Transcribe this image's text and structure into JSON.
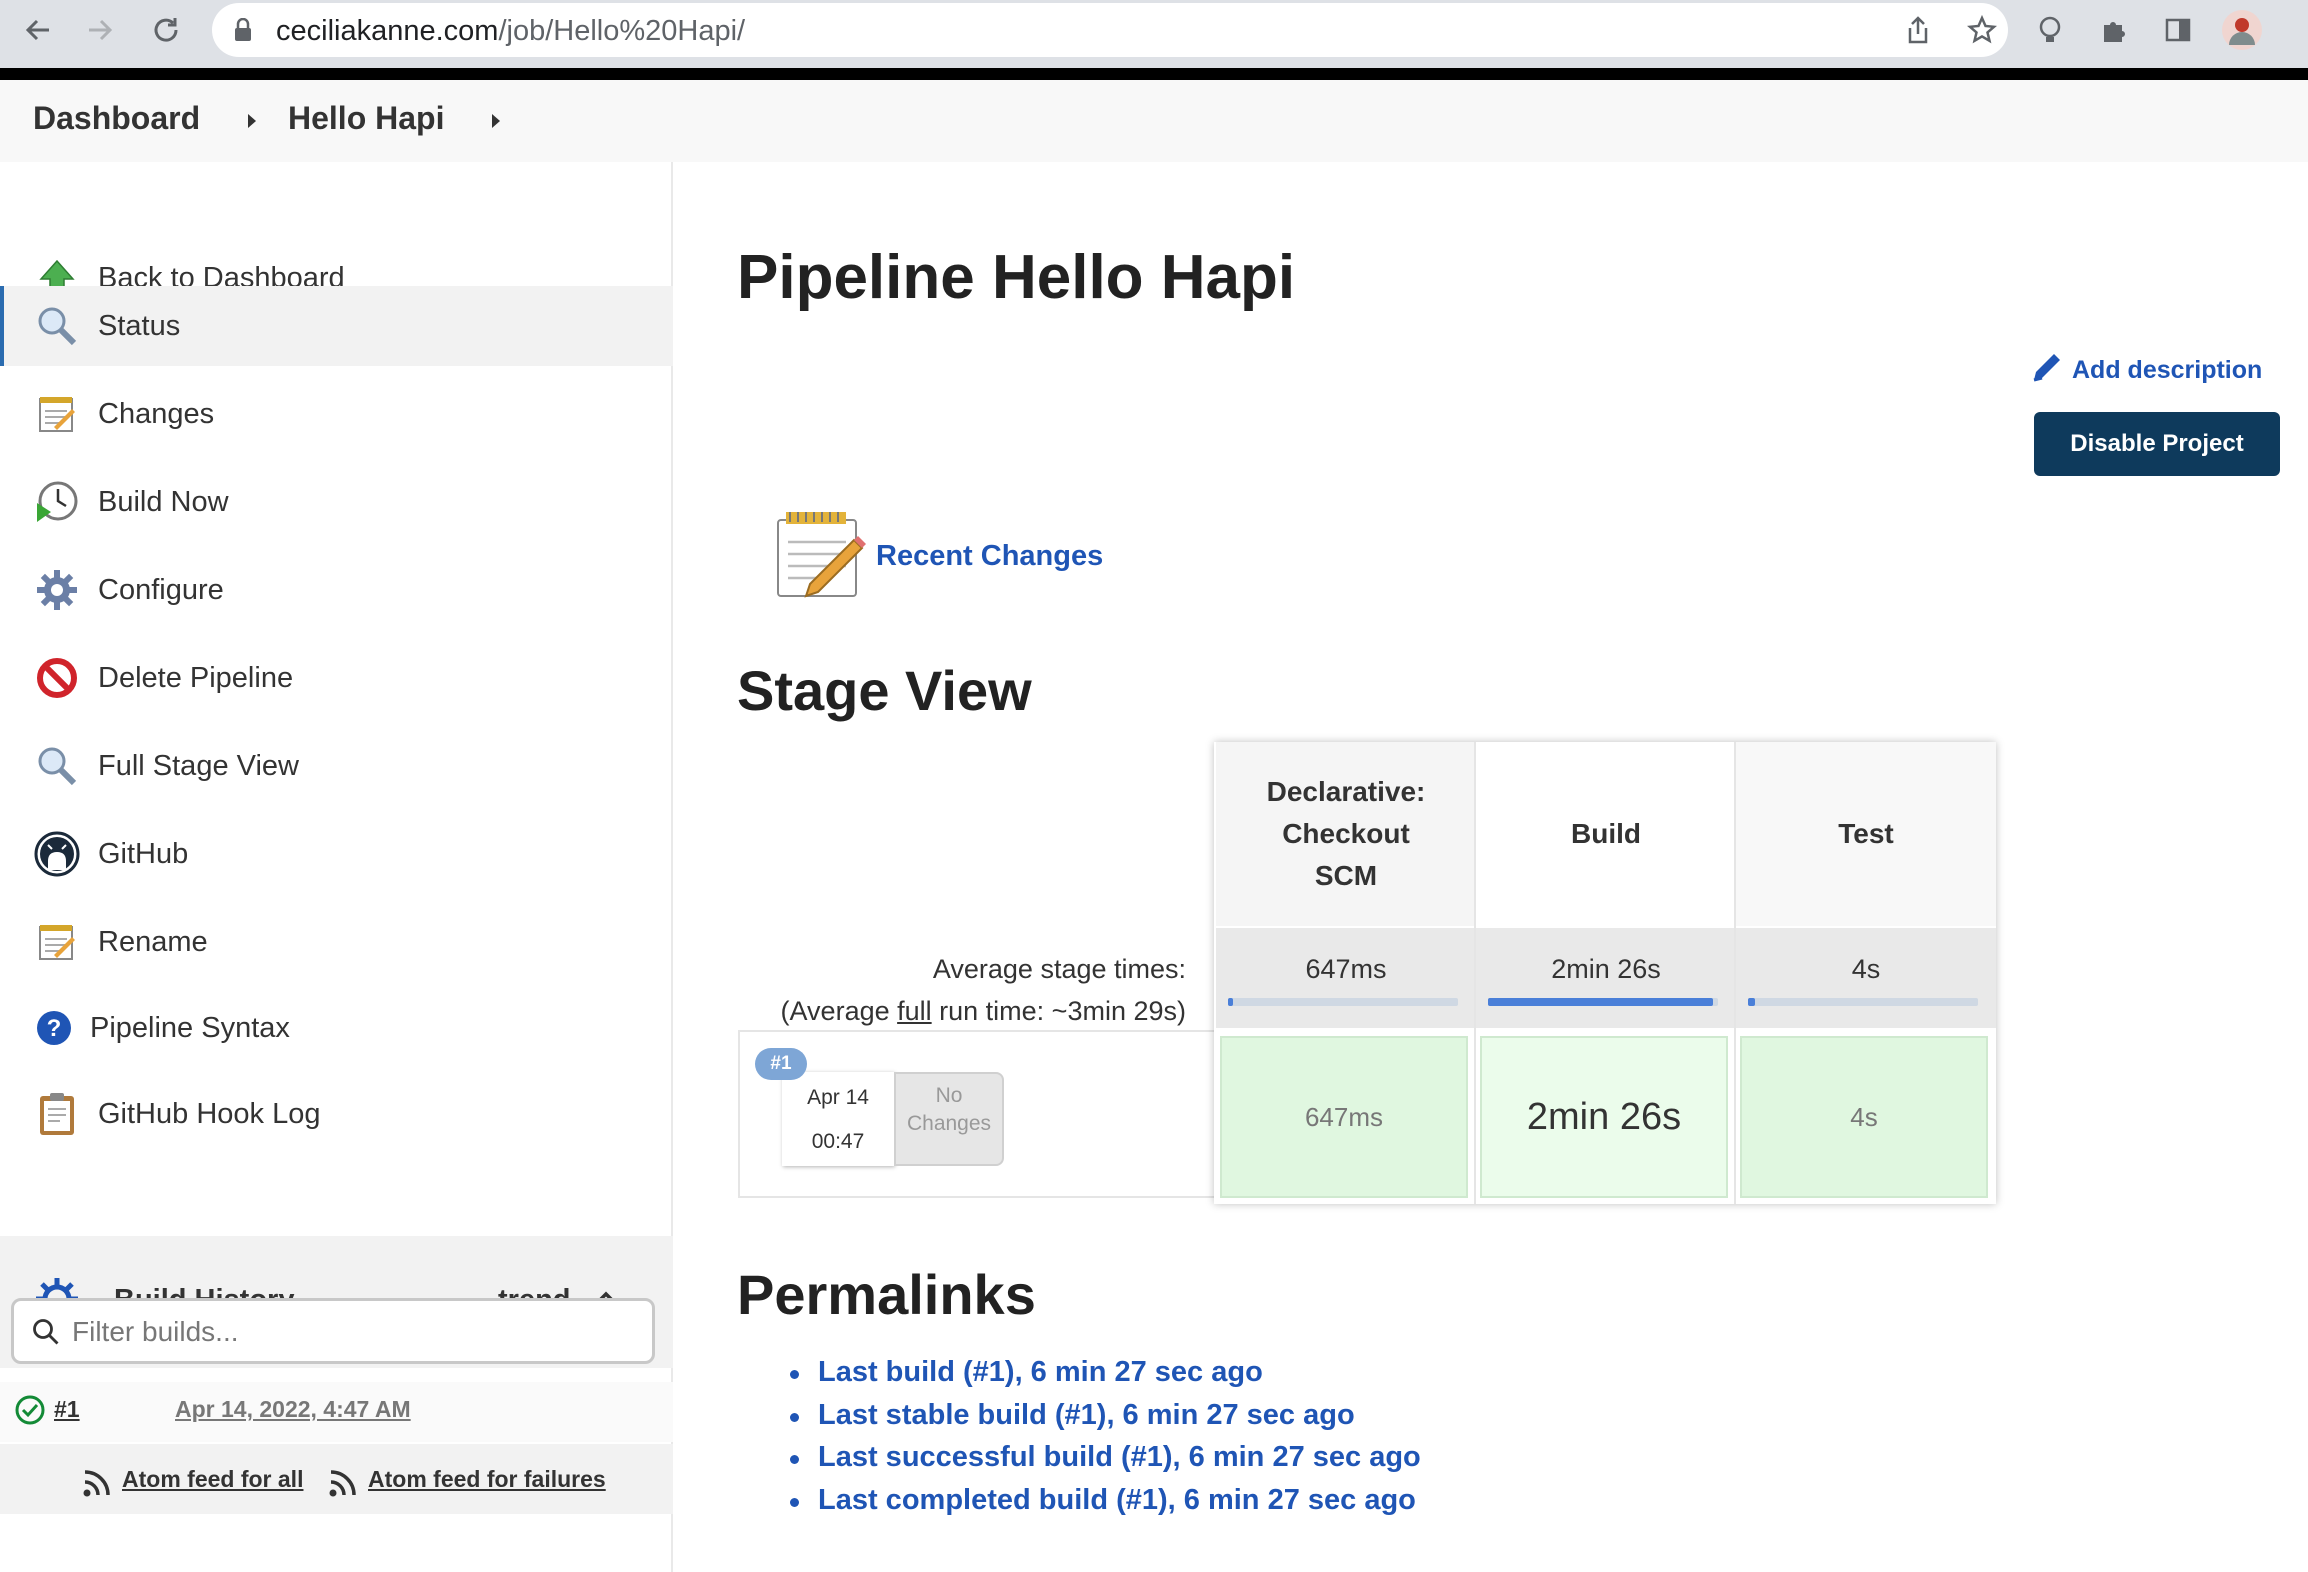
{
  "browser": {
    "url_host": "ceciliakanne.com",
    "url_path": "/job/Hello%20Hapi/"
  },
  "breadcrumb": {
    "items": [
      "Dashboard",
      "Hello Hapi"
    ]
  },
  "sidebar": {
    "tasks": [
      {
        "label": "Back to Dashboard",
        "icon": "up-arrow-icon"
      },
      {
        "label": "Status",
        "icon": "magnifier-icon"
      },
      {
        "label": "Changes",
        "icon": "notepad-icon"
      },
      {
        "label": "Build Now",
        "icon": "clock-play-icon"
      },
      {
        "label": "Configure",
        "icon": "gear-icon"
      },
      {
        "label": "Delete Pipeline",
        "icon": "no-entry-icon"
      },
      {
        "label": "Full Stage View",
        "icon": "magnifier-icon"
      },
      {
        "label": "GitHub",
        "icon": "github-icon"
      },
      {
        "label": "Rename",
        "icon": "notepad-icon"
      },
      {
        "label": "Pipeline Syntax",
        "icon": "help-icon"
      },
      {
        "label": "GitHub Hook Log",
        "icon": "clipboard-icon"
      }
    ],
    "build_history": {
      "title": "Build History",
      "trend": "trend",
      "filter_placeholder": "Filter builds...",
      "builds": [
        {
          "number": "#1",
          "date": "Apr 14, 2022, 4:47 AM",
          "status": "success"
        }
      ],
      "feed_all": "Atom feed for all",
      "feed_failures": "Atom feed for failures"
    }
  },
  "main": {
    "title": "Pipeline Hello Hapi",
    "add_description": "Add description",
    "disable_button": "Disable Project",
    "recent_changes": "Recent Changes",
    "stage_view": {
      "heading": "Stage View",
      "avg_label": "Average stage times:",
      "avg_run_prefix": "(Average ",
      "avg_run_full": "full",
      "avg_run_suffix": " run time: ~3min 29s)",
      "stages": [
        {
          "name": "Declarative: Checkout SCM",
          "lines": [
            "Declarative:",
            "Checkout",
            "SCM"
          ],
          "avg": "647ms",
          "avg_fraction": 0.0,
          "run": "647ms"
        },
        {
          "name": "Build",
          "lines": [
            "Build"
          ],
          "avg": "2min 26s",
          "avg_fraction": 0.98,
          "run": "2min 26s"
        },
        {
          "name": "Test",
          "lines": [
            "Test"
          ],
          "avg": "4s",
          "avg_fraction": 0.03,
          "run": "4s"
        }
      ],
      "run": {
        "badge": "#1",
        "date": "Apr 14",
        "time": "00:47",
        "changes_line1": "No",
        "changes_line2": "Changes"
      }
    },
    "permalinks": {
      "heading": "Permalinks",
      "links": [
        "Last build (#1), 6 min 27 sec ago",
        "Last stable build (#1), 6 min 27 sec ago",
        "Last successful build (#1), 6 min 27 sec ago",
        "Last completed build (#1), 6 min 27 sec ago"
      ]
    }
  }
}
